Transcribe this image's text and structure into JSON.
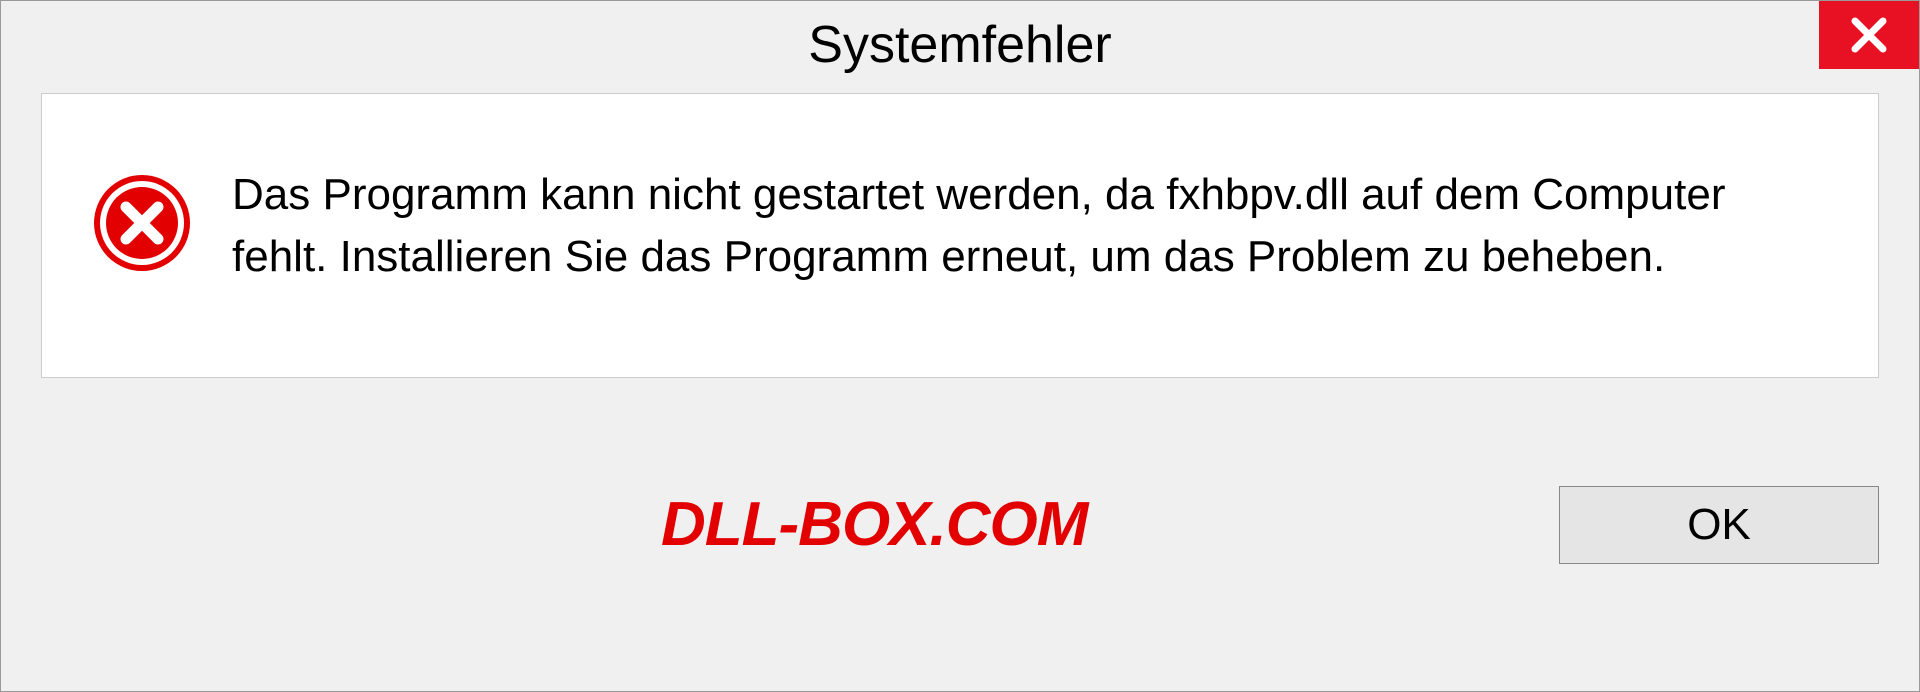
{
  "titlebar": {
    "title": "Systemfehler"
  },
  "message": {
    "text": "Das Programm kann nicht gestartet werden, da fxhbpv.dll auf dem Computer fehlt. Installieren Sie das Programm erneut, um das Problem zu beheben."
  },
  "footer": {
    "watermark": "DLL-BOX.COM",
    "ok_label": "OK"
  }
}
